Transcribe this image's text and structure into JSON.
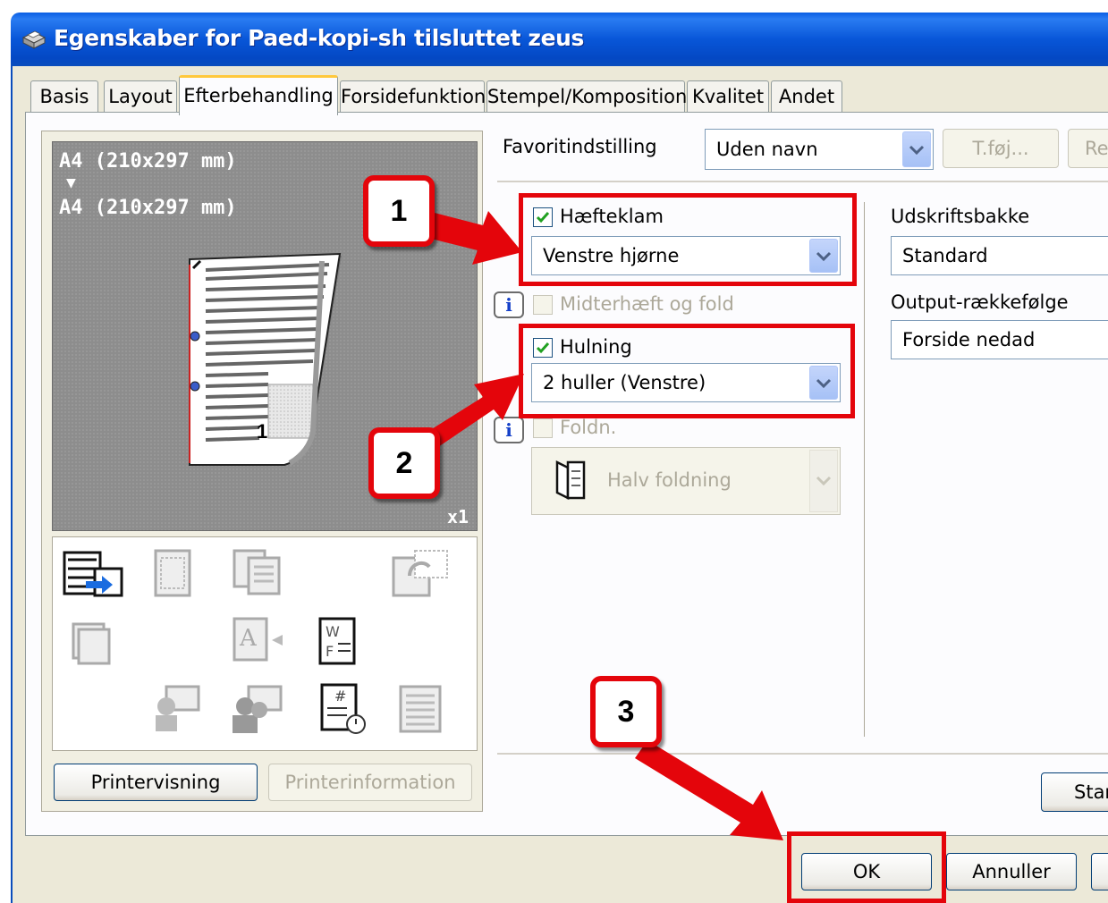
{
  "window": {
    "title": "Egenskaber for Paed-kopi-sh tilsluttet zeus"
  },
  "tabs": [
    {
      "label": "Basis",
      "active": false
    },
    {
      "label": "Layout",
      "active": false
    },
    {
      "label": "Efterbehandling",
      "active": true
    },
    {
      "label": "Forsidefunktion",
      "active": false
    },
    {
      "label": "Stempel/Komposition",
      "active": false
    },
    {
      "label": "Kvalitet",
      "active": false
    },
    {
      "label": "Andet",
      "active": false
    }
  ],
  "preview": {
    "paper_line1": "A4 (210x297 mm)",
    "arrow": "▼",
    "paper_line2": "A4 (210x297 mm)",
    "page_number": "1",
    "copies": "x1",
    "buttons": {
      "printer_view": "Printervisning",
      "printer_info": "Printerinformation"
    }
  },
  "favorites": {
    "label": "Favoritindstilling",
    "value": "Uden navn",
    "add_button": "T.føj...",
    "edit_button": "Re"
  },
  "staple": {
    "checkbox_label": "Hæfteklam",
    "checked": true,
    "value": "Venstre hjørne"
  },
  "center_staple": {
    "checkbox_label": "Midterhæft og fold",
    "checked": false,
    "enabled": false
  },
  "punch": {
    "checkbox_label": "Hulning",
    "checked": true,
    "value": "2 huller (Venstre)"
  },
  "fold": {
    "checkbox_label": "Foldn.",
    "checked": false,
    "enabled": false,
    "value": "Halv foldning"
  },
  "output_tray": {
    "label": "Udskriftsbakke",
    "value": "Standard"
  },
  "output_order": {
    "label": "Output-rækkefølge",
    "value": "Forside nedad"
  },
  "footer": {
    "standard_button": "Star",
    "ok_button": "OK",
    "cancel_button": "Annuller"
  },
  "annotations": {
    "callout_1": "1",
    "callout_2": "2",
    "callout_3": "3",
    "highlight_color": "#e4050b"
  }
}
